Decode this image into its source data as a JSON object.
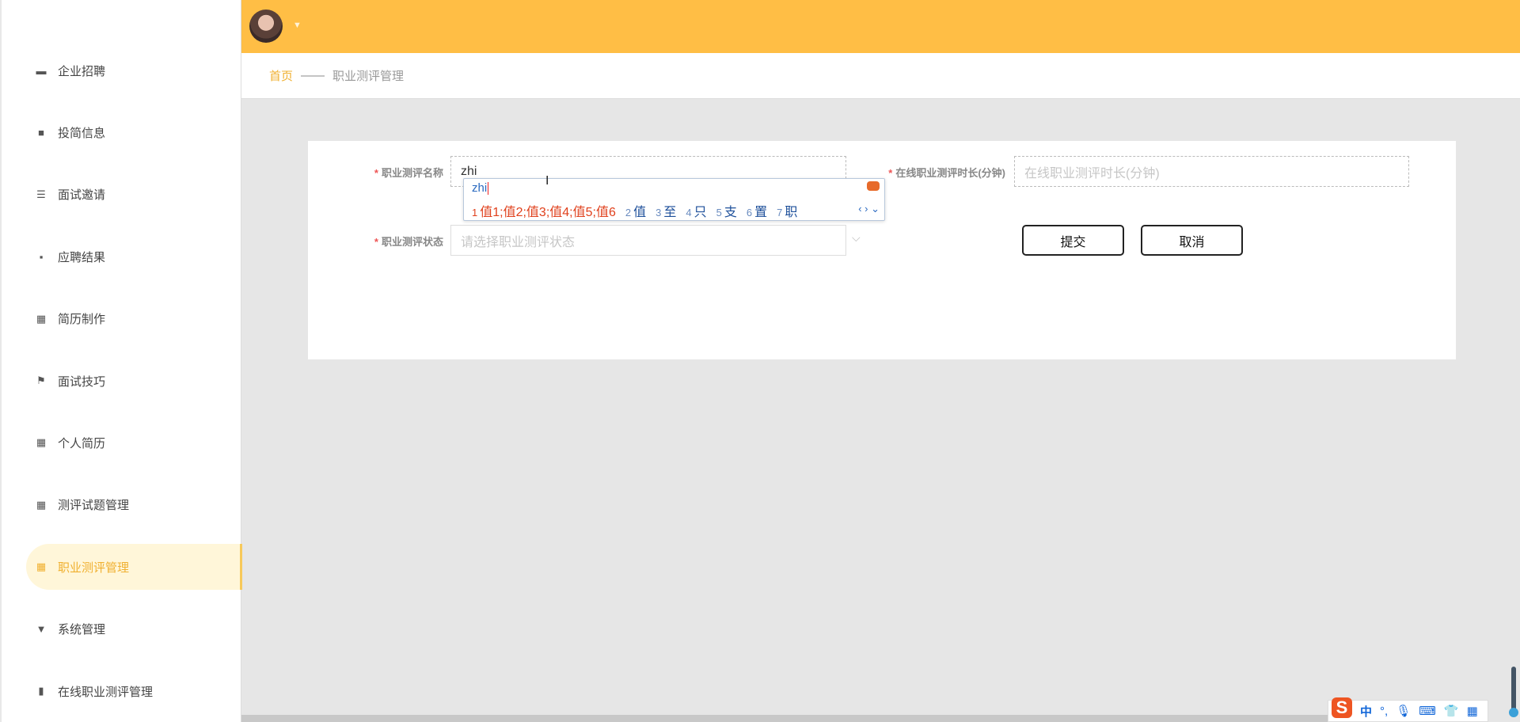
{
  "sidebar": {
    "items": [
      {
        "label": "企业招聘",
        "icon": "monitor-icon"
      },
      {
        "label": "投简信息",
        "icon": "briefcase-icon"
      },
      {
        "label": "面试邀请",
        "icon": "sliders-icon"
      },
      {
        "label": "应聘结果",
        "icon": "chat-icon"
      },
      {
        "label": "简历制作",
        "icon": "grid-icon"
      },
      {
        "label": "面试技巧",
        "icon": "flag-icon"
      },
      {
        "label": "个人简历",
        "icon": "grid-icon"
      },
      {
        "label": "测评试题管理",
        "icon": "grid-icon"
      },
      {
        "label": "职业测评管理",
        "icon": "grid-icon",
        "active": true
      },
      {
        "label": "系统管理",
        "icon": "stamp-icon"
      },
      {
        "label": "在线职业测评管理",
        "icon": "bar-chart-icon"
      }
    ]
  },
  "breadcrumb": {
    "home": "首页",
    "separator": "——",
    "current": "职业测评管理"
  },
  "form": {
    "name_label": "职业测评名称",
    "name_value": "zhi",
    "duration_label": "在线职业测评时长(分钟)",
    "duration_placeholder": "在线职业测评时长(分钟)",
    "status_label": "职业测评状态",
    "status_placeholder": "请选择职业测评状态",
    "required_mark": "*",
    "submit": "提交",
    "cancel": "取消"
  },
  "ime": {
    "pinyin": "zhi",
    "candidates": [
      {
        "n": "1",
        "text": "值1;值2;值3;值4;值5;值6"
      },
      {
        "n": "2",
        "text": "值"
      },
      {
        "n": "3",
        "text": "至"
      },
      {
        "n": "4",
        "text": "只"
      },
      {
        "n": "5",
        "text": "支"
      },
      {
        "n": "6",
        "text": "置"
      },
      {
        "n": "7",
        "text": "职"
      }
    ]
  },
  "imebar": {
    "logo": "S",
    "mode": "中",
    "punct": "°,"
  },
  "colors": {
    "accent": "#ffbe45",
    "active": "#f0b030"
  }
}
